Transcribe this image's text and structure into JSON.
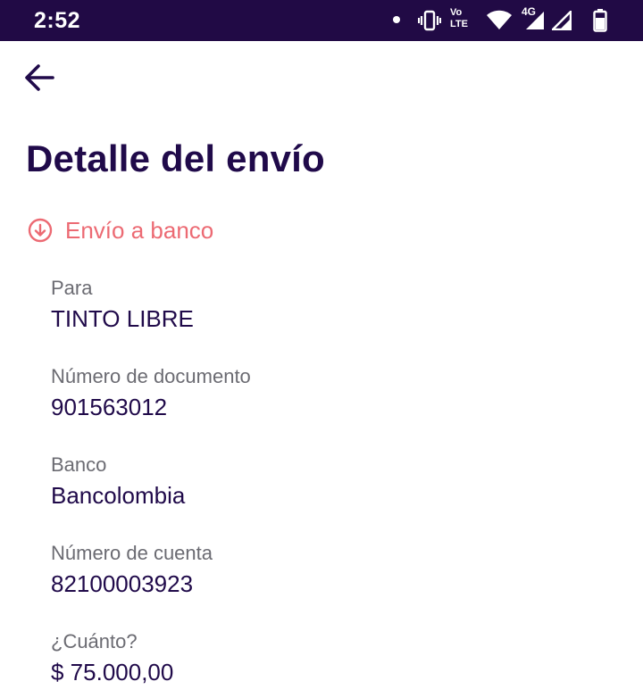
{
  "status_bar": {
    "time": "2:52",
    "volte_top": "Vo",
    "volte_bottom": "LTE",
    "network": "4G",
    "colors": {
      "background": "#210a45",
      "foreground": "#ffffff"
    }
  },
  "header": {
    "back_icon": "arrow-left-icon",
    "title": "Detalle del envío"
  },
  "transfer_type": {
    "icon": "arrow-down-circle-icon",
    "label": "Envío a banco",
    "color": "#ec6a73"
  },
  "details": [
    {
      "label": "Para",
      "value": "TINTO LIBRE"
    },
    {
      "label": "Número de documento",
      "value": "901563012"
    },
    {
      "label": "Banco",
      "value": "Bancolombia"
    },
    {
      "label": "Número de cuenta",
      "value": "82100003923"
    },
    {
      "label": "¿Cuánto?",
      "value": "$ 75.000,00"
    }
  ],
  "colors": {
    "primary": "#200a4a",
    "label": "#6b6b72",
    "background": "#ffffff"
  }
}
